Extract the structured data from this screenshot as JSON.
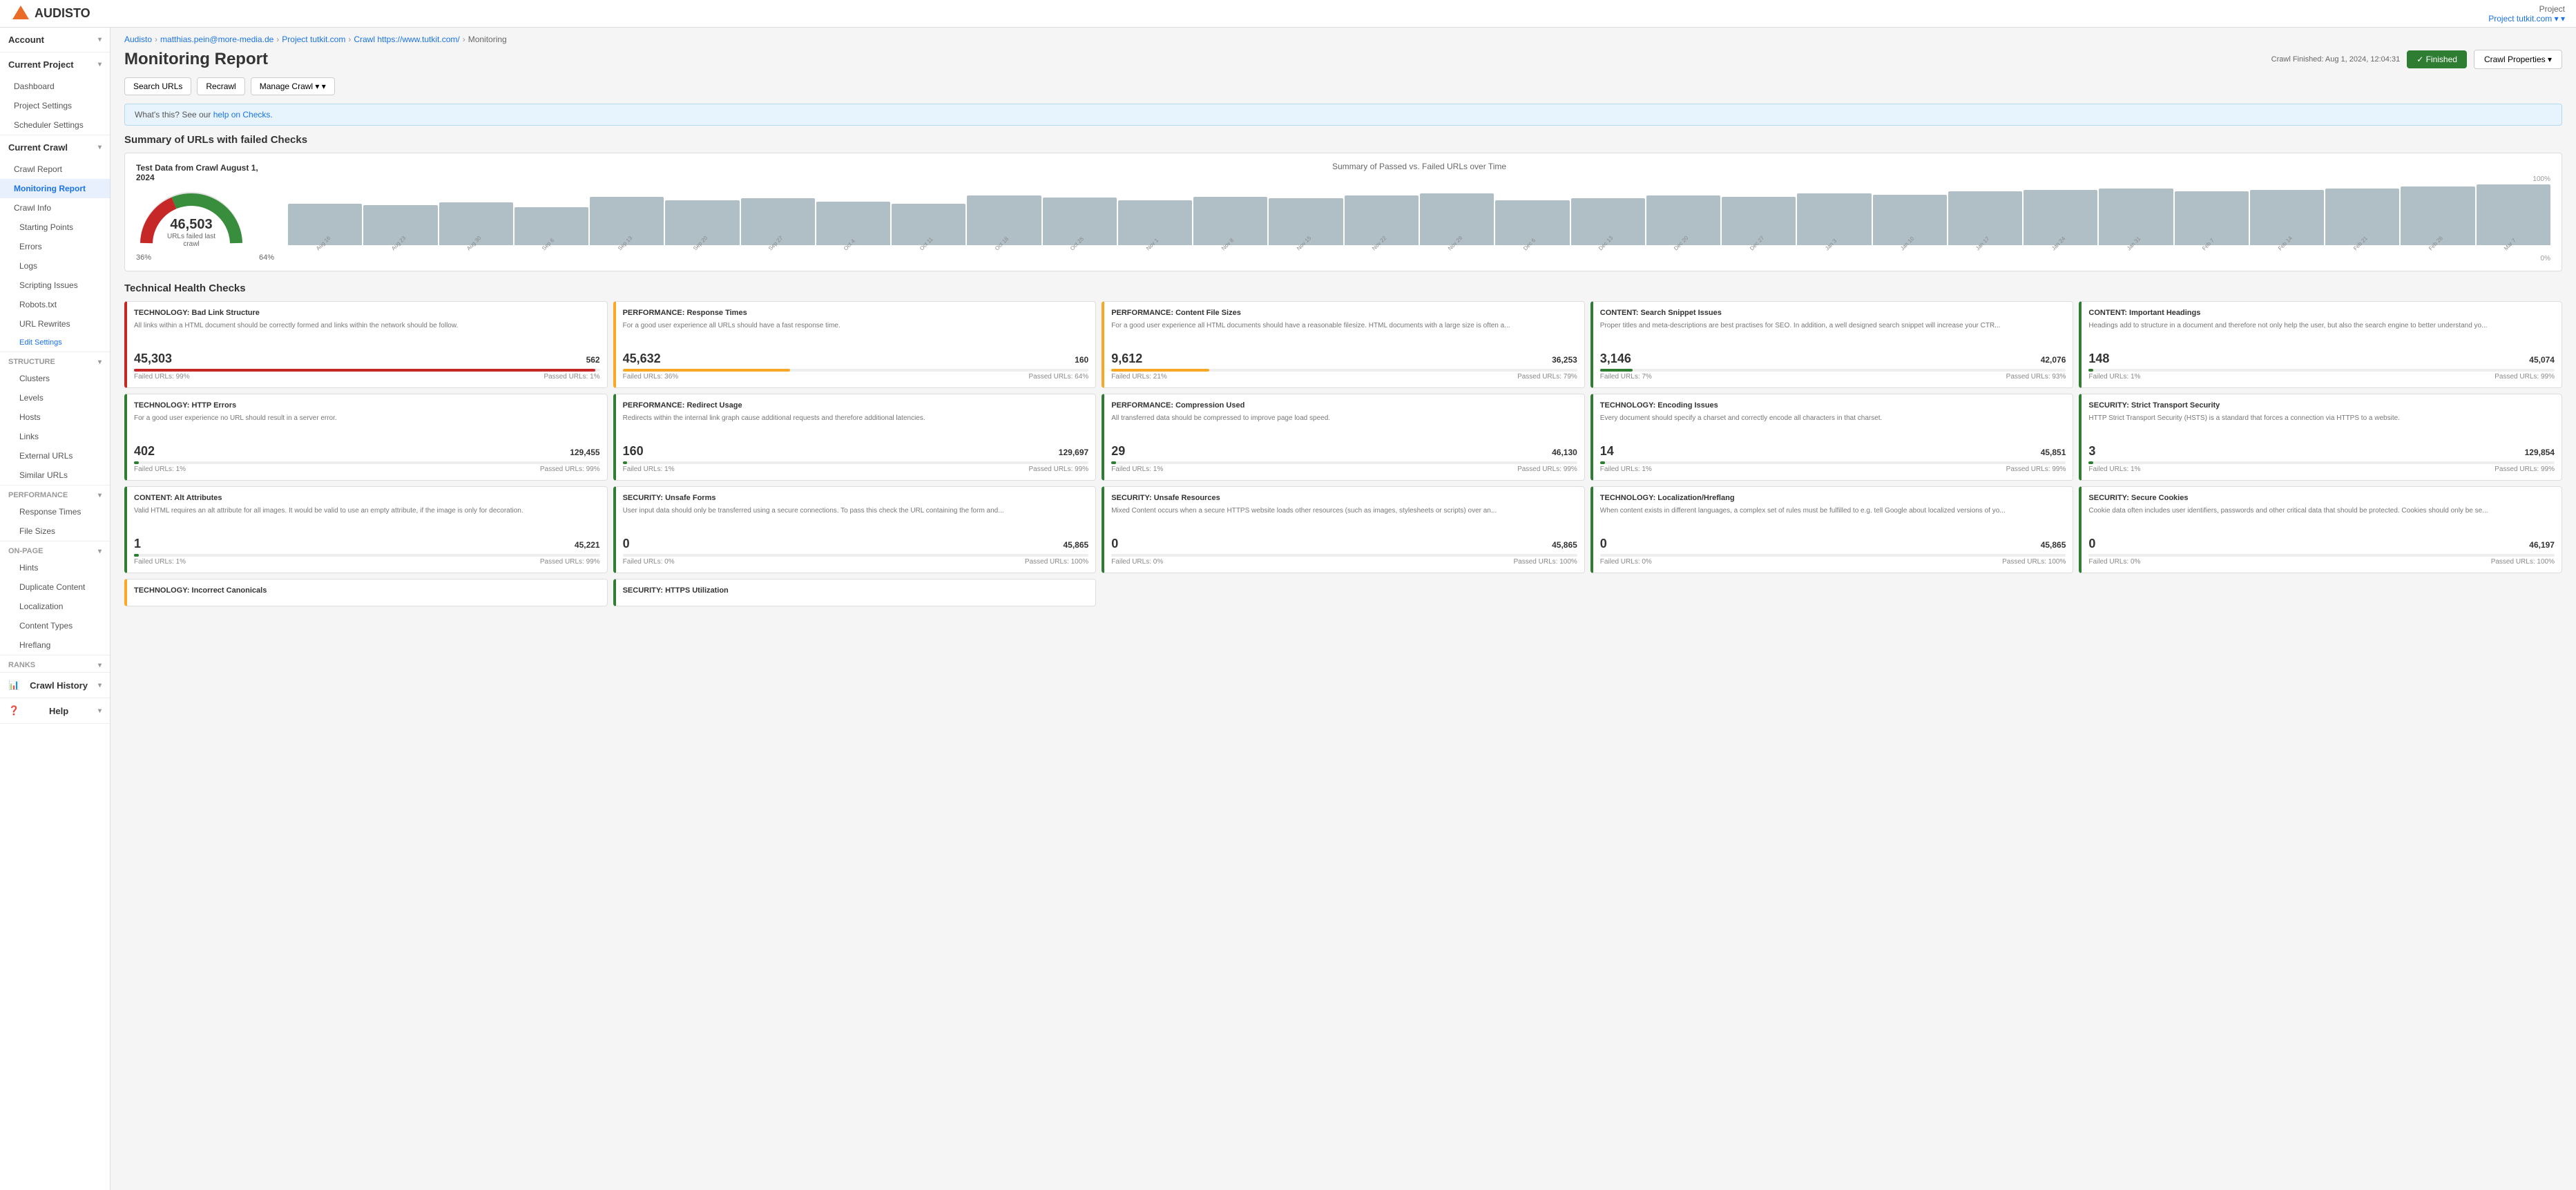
{
  "topbar": {
    "logo": "AUDISTO",
    "project_label": "Project",
    "project_name": "Project tutkit.com ▾"
  },
  "breadcrumb": [
    {
      "label": "Audisto",
      "url": "#"
    },
    {
      "label": "matthias.pein@more-media.de",
      "url": "#"
    },
    {
      "label": "Project tutkit.com",
      "url": "#"
    },
    {
      "label": "Crawl https://www.tutkit.com/",
      "url": "#"
    },
    {
      "label": "Monitoring",
      "url": "#"
    }
  ],
  "page": {
    "title": "Monitoring Report",
    "crawl_finished": "Crawl Finished: Aug 1, 2024, 12:04:31",
    "finished_btn": "✓ Finished",
    "crawl_props_btn": "Crawl Properties ▾"
  },
  "toolbar": {
    "search_urls": "Search URLs",
    "recrawl": "Recrawl",
    "manage_crawl": "Manage Crawl ▾"
  },
  "banner": {
    "text": "What's this? See our ",
    "link_text": "help on Checks.",
    "link_url": "#"
  },
  "summary": {
    "title": "Summary of URLs with failed Checks",
    "gauge": {
      "title": "Test Data from Crawl August 1, 2024",
      "value": "46,503",
      "subtitle": "URLs failed last crawl",
      "left_label": "36%",
      "right_label": "64%"
    },
    "chart": {
      "title": "Summary of Passed vs. Failed URLs over Time",
      "y_top": "100%",
      "y_bottom": "0%",
      "bars": [
        {
          "label": "Aug 16",
          "height": 60
        },
        {
          "label": "Aug 23",
          "height": 58
        },
        {
          "label": "Aug 30",
          "height": 62
        },
        {
          "label": "Sep 6",
          "height": 55
        },
        {
          "label": "Sep 13",
          "height": 70
        },
        {
          "label": "Sep 20",
          "height": 65
        },
        {
          "label": "Sep 27",
          "height": 68
        },
        {
          "label": "Oct 4",
          "height": 63
        },
        {
          "label": "Oct 11",
          "height": 60
        },
        {
          "label": "Oct 18",
          "height": 72
        },
        {
          "label": "Oct 25",
          "height": 69
        },
        {
          "label": "Nov 1",
          "height": 65
        },
        {
          "label": "Nov 8",
          "height": 70
        },
        {
          "label": "Nov 15",
          "height": 68
        },
        {
          "label": "Nov 22",
          "height": 72
        },
        {
          "label": "Nov 29",
          "height": 75
        },
        {
          "label": "Dec 6",
          "height": 65
        },
        {
          "label": "Dec 13",
          "height": 68
        },
        {
          "label": "Dec 20",
          "height": 72
        },
        {
          "label": "Dec 27",
          "height": 70
        },
        {
          "label": "Jan 3",
          "height": 75
        },
        {
          "label": "Jan 10",
          "height": 73
        },
        {
          "label": "Jan 17",
          "height": 78
        },
        {
          "label": "Jan 24",
          "height": 80
        },
        {
          "label": "Jan 31",
          "height": 82
        },
        {
          "label": "Feb 7",
          "height": 78
        },
        {
          "label": "Feb 14",
          "height": 80
        },
        {
          "label": "Feb 21",
          "height": 82
        },
        {
          "label": "Feb 28",
          "height": 85
        },
        {
          "label": "Mar 7",
          "height": 88
        }
      ]
    }
  },
  "health_checks": {
    "title": "Technical Health Checks",
    "cards": [
      {
        "color": "red",
        "title": "TECHNOLOGY: Bad Link Structure",
        "desc": "All links within a HTML document should be correctly formed and links within the network should be follow.",
        "big": "45,303",
        "small": "562",
        "failed_pct": "Failed URLs: 99%",
        "passed_pct": "Passed URLs: 1%",
        "fill_color": "#c62828",
        "fill_pct": 99
      },
      {
        "color": "yellow",
        "title": "PERFORMANCE: Response Times",
        "desc": "For a good user experience all URLs should have a fast response time.",
        "big": "45,632",
        "small": "160",
        "failed_pct": "Failed URLs: 36%",
        "passed_pct": "Passed URLs: 64%",
        "fill_color": "#f9a825",
        "fill_pct": 36
      },
      {
        "color": "yellow",
        "title": "PERFORMANCE: Content File Sizes",
        "desc": "For a good user experience all HTML documents should have a reasonable filesize. HTML documents with a large size is often a...",
        "big": "9,612",
        "small": "36,253",
        "failed_pct": "Failed URLs: 21%",
        "passed_pct": "Passed URLs: 79%",
        "fill_color": "#f9a825",
        "fill_pct": 21
      },
      {
        "color": "green",
        "title": "CONTENT: Search Snippet Issues",
        "desc": "Proper titles and meta-descriptions are best practises for SEO. In addition, a well designed search snippet will increase your CTR...",
        "big": "3,146",
        "small": "42,076",
        "failed_pct": "Failed URLs: 7%",
        "passed_pct": "Passed URLs: 93%",
        "fill_color": "#2e7d32",
        "fill_pct": 7
      },
      {
        "color": "green",
        "title": "CONTENT: Important Headings",
        "desc": "Headings add to structure in a document and therefore not only help the user, but also the search engine to better understand yo...",
        "big": "148",
        "small": "45,074",
        "failed_pct": "Failed URLs: 1%",
        "passed_pct": "Passed URLs: 99%",
        "fill_color": "#2e7d32",
        "fill_pct": 1
      },
      {
        "color": "green",
        "title": "TECHNOLOGY: HTTP Errors",
        "desc": "For a good user experience no URL should result in a server error.",
        "big": "402",
        "small": "129,455",
        "failed_pct": "Failed URLs: 1%",
        "passed_pct": "Passed URLs: 99%",
        "fill_color": "#2e7d32",
        "fill_pct": 1
      },
      {
        "color": "green",
        "title": "PERFORMANCE: Redirect Usage",
        "desc": "Redirects within the internal link graph cause additional requests and therefore additional latencies.",
        "big": "160",
        "small": "129,697",
        "failed_pct": "Failed URLs: 1%",
        "passed_pct": "Passed URLs: 99%",
        "fill_color": "#2e7d32",
        "fill_pct": 1
      },
      {
        "color": "green",
        "title": "PERFORMANCE: Compression Used",
        "desc": "All transferred data should be compressed to improve page load speed.",
        "big": "29",
        "small": "46,130",
        "failed_pct": "Failed URLs: 1%",
        "passed_pct": "Passed URLs: 99%",
        "fill_color": "#2e7d32",
        "fill_pct": 1
      },
      {
        "color": "green",
        "title": "TECHNOLOGY: Encoding Issues",
        "desc": "Every document should specify a charset and correctly encode all characters in that charset.",
        "big": "14",
        "small": "45,851",
        "failed_pct": "Failed URLs: 1%",
        "passed_pct": "Passed URLs: 99%",
        "fill_color": "#2e7d32",
        "fill_pct": 1
      },
      {
        "color": "green",
        "title": "SECURITY: Strict Transport Security",
        "desc": "HTTP Strict Transport Security (HSTS) is a standard that forces a connection via HTTPS to a website.",
        "big": "3",
        "small": "129,854",
        "failed_pct": "Failed URLs: 1%",
        "passed_pct": "Passed URLs: 99%",
        "fill_color": "#2e7d32",
        "fill_pct": 1
      },
      {
        "color": "green",
        "title": "CONTENT: Alt Attributes",
        "desc": "Valid HTML requires an alt attribute for all images. It would be valid to use an empty attribute, if the image is only for decoration.",
        "big": "1",
        "small": "45,221",
        "failed_pct": "Failed URLs: 1%",
        "passed_pct": "Passed URLs: 99%",
        "fill_color": "#2e7d32",
        "fill_pct": 1
      },
      {
        "color": "green",
        "title": "SECURITY: Unsafe Forms",
        "desc": "User input data should only be transferred using a secure connections. To pass this check the URL containing the form and...",
        "big": "0",
        "small": "45,865",
        "failed_pct": "Failed URLs: 0%",
        "passed_pct": "Passed URLs: 100%",
        "fill_color": "#2e7d32",
        "fill_pct": 0
      },
      {
        "color": "green",
        "title": "SECURITY: Unsafe Resources",
        "desc": "Mixed Content occurs when a secure HTTPS website loads other resources (such as images, stylesheets or scripts) over an...",
        "big": "0",
        "small": "45,865",
        "failed_pct": "Failed URLs: 0%",
        "passed_pct": "Passed URLs: 100%",
        "fill_color": "#2e7d32",
        "fill_pct": 0
      },
      {
        "color": "green",
        "title": "TECHNOLOGY: Localization/Hreflang",
        "desc": "When content exists in different languages, a complex set of rules must be fulfilled to e.g. tell Google about localized versions of yo...",
        "big": "0",
        "small": "45,865",
        "failed_pct": "Failed URLs: 0%",
        "passed_pct": "Passed URLs: 100%",
        "fill_color": "#2e7d32",
        "fill_pct": 0
      },
      {
        "color": "green",
        "title": "SECURITY: Secure Cookies",
        "desc": "Cookie data often includes user identifiers, passwords and other critical data that should be protected. Cookies should only be se...",
        "big": "0",
        "small": "46,197",
        "failed_pct": "Failed URLs: 0%",
        "passed_pct": "Passed URLs: 100%",
        "fill_color": "#2e7d32",
        "fill_pct": 0
      }
    ],
    "bottom_cards": [
      {
        "color": "yellow",
        "title": "TECHNOLOGY: Incorrect Canonicals"
      },
      {
        "color": "green",
        "title": "SECURITY: HTTPS Utilization"
      }
    ]
  },
  "sidebar": {
    "account": "Account",
    "current_project": "Current Project",
    "dashboard": "Dashboard",
    "project_settings": "Project Settings",
    "scheduler_settings": "Scheduler Settings",
    "current_crawl": "Current Crawl",
    "crawl_report": "Crawl Report",
    "monitoring_report": "Monitoring Report",
    "crawl_info": "Crawl Info",
    "starting_points": "Starting Points",
    "errors": "Errors",
    "logs": "Logs",
    "scripting_issues": "Scripting Issues",
    "robots_txt": "Robots.txt",
    "url_rewrites": "URL Rewrites",
    "edit_settings": "Edit Settings",
    "structure": "Structure",
    "clusters": "Clusters",
    "levels": "Levels",
    "hosts": "Hosts",
    "links": "Links",
    "external_urls": "External URLs",
    "similar_urls": "Similar URLs",
    "performance": "Performance",
    "response_times": "Response Times",
    "file_sizes": "File Sizes",
    "on_page": "On-page",
    "hints": "Hints",
    "duplicate_content": "Duplicate Content",
    "localization": "Localization",
    "content_types": "Content Types",
    "hreflang": "Hreflang",
    "ranks": "Ranks",
    "crawl_history": "Crawl History",
    "help": "Help"
  }
}
